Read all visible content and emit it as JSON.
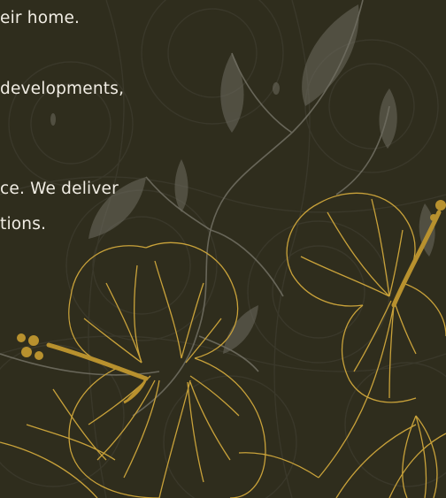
{
  "text_lines": [
    "eir home.",
    "developments,",
    "ce. We deliver",
    "tions."
  ],
  "colors": {
    "background": "#2f2d1d",
    "pattern_line": "#3a382a",
    "text": "#f1ede4",
    "gold": "#c9a23a",
    "gold_fill": "#b8912e",
    "leaf": "#6e6c60",
    "stem": "#7c7a6e"
  }
}
